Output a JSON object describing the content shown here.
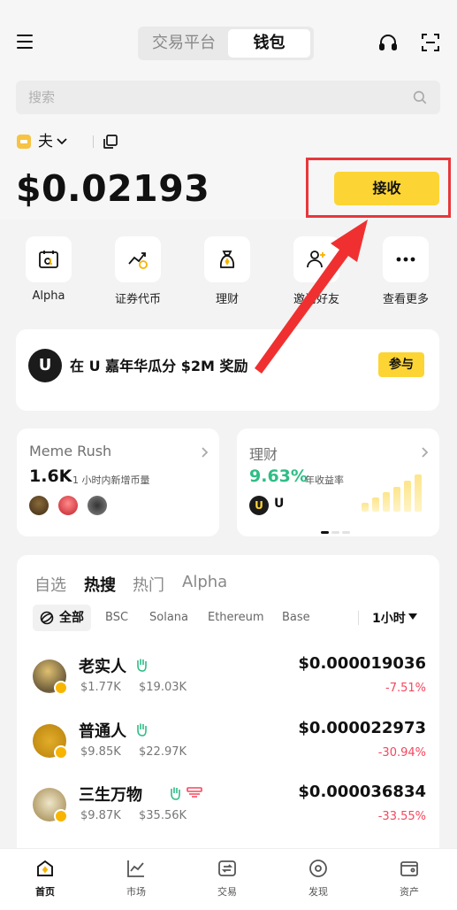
{
  "header": {
    "tabs": [
      {
        "label": "交易平台",
        "active": false
      },
      {
        "label": "钱包",
        "active": true
      }
    ],
    "icons": [
      "menu-icon",
      "headset-icon",
      "scan-icon"
    ]
  },
  "search": {
    "placeholder": "搜索"
  },
  "account": {
    "name": "夫"
  },
  "balance": "$0.02193",
  "receive_label": "接收",
  "quick_actions": [
    {
      "label": "Alpha",
      "icon": "alpha-icon"
    },
    {
      "label": "证券代币",
      "icon": "stock-token-icon"
    },
    {
      "label": "理财",
      "icon": "earn-icon"
    },
    {
      "label": "邀请好友",
      "icon": "invite-friends-icon"
    },
    {
      "label": "查看更多",
      "icon": "more-icon"
    }
  ],
  "promo": {
    "text": "在 U 嘉年华瓜分 $2M 奖励",
    "button": "参与",
    "logo_letter": "U"
  },
  "cards": {
    "meme": {
      "title": "Meme Rush",
      "value": "1.6K",
      "sub": "1 小时内新增币量"
    },
    "earn": {
      "title": "理财",
      "value": "9.63%",
      "sub": "年收益率",
      "coin": "U",
      "coin_label": "U"
    }
  },
  "market": {
    "tabs": [
      {
        "label": "自选",
        "active": false
      },
      {
        "label": "热搜",
        "active": true
      },
      {
        "label": "热门",
        "active": false
      },
      {
        "label": "Alpha",
        "active": false
      }
    ],
    "chains": [
      {
        "label": "全部",
        "active": true
      },
      {
        "label": "BSC",
        "active": false
      },
      {
        "label": "Solana",
        "active": false
      },
      {
        "label": "Ethereum",
        "active": false
      },
      {
        "label": "Base",
        "active": false
      }
    ],
    "period": "1小时",
    "tokens": [
      {
        "name": "老实人",
        "liquidity": "$1.77K",
        "mcap": "$19.03K",
        "price": "$0.000019036",
        "change": "-7.51%"
      },
      {
        "name": "普通人",
        "liquidity": "$9.85K",
        "mcap": "$22.97K",
        "price": "$0.000022973",
        "change": "-30.94%"
      },
      {
        "name": "三生万物",
        "liquidity": "$9.87K",
        "mcap": "$35.56K",
        "price": "$0.000036834",
        "change": "-33.55%"
      }
    ]
  },
  "bottom_nav": [
    {
      "label": "首页",
      "active": true
    },
    {
      "label": "市场",
      "active": false
    },
    {
      "label": "交易",
      "active": false
    },
    {
      "label": "发现",
      "active": false
    },
    {
      "label": "资产",
      "active": false
    }
  ],
  "colors": {
    "accent": "#fcd535",
    "up": "#2ebd85",
    "down": "#f6465d",
    "highlight": "#e8373b"
  }
}
